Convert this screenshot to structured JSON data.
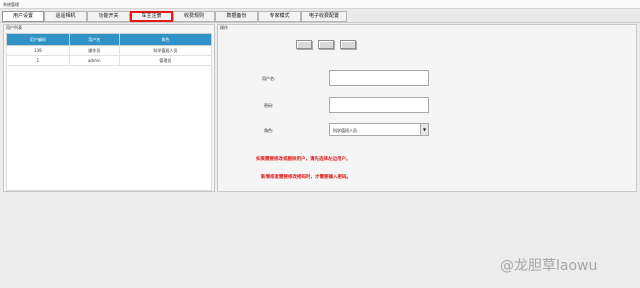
{
  "window": {
    "title": "系统管理"
  },
  "tabs": [
    {
      "label": "用户设置",
      "active": true,
      "highlighted": false
    },
    {
      "label": "遥遥相机",
      "active": false,
      "highlighted": false
    },
    {
      "label": "功能开关",
      "active": false,
      "highlighted": false
    },
    {
      "label": "车主注册",
      "active": false,
      "highlighted": true
    },
    {
      "label": "收费规则",
      "active": false,
      "highlighted": false
    },
    {
      "label": "数据备份",
      "active": false,
      "highlighted": false
    },
    {
      "label": "专家模式",
      "active": false,
      "highlighted": false
    },
    {
      "label": "电子收费配置",
      "active": false,
      "highlighted": false
    }
  ],
  "user_list": {
    "title": "用户列表",
    "columns": [
      "用户编码",
      "用户名",
      "角色"
    ],
    "rows": [
      [
        "139",
        "操作员",
        "科学值班人员"
      ],
      [
        "1",
        "admin",
        "管理员"
      ]
    ]
  },
  "operation": {
    "title": "操作",
    "username_label": "用户名:",
    "username_value": "",
    "password_label": "密码:",
    "password_value": "",
    "role_label": "角色:",
    "role_value": "科学值班人员",
    "note1": "如果需要修改或删除用户，请先选择左边用户。",
    "note2": "新增或者需要修改密码时，才需要输入密码。"
  },
  "watermark": {
    "text": "@龙胆草laowu"
  },
  "colors": {
    "table_header": "#2f93c7",
    "highlight_border": "#e11a1a",
    "note_text": "#e01b1b"
  }
}
